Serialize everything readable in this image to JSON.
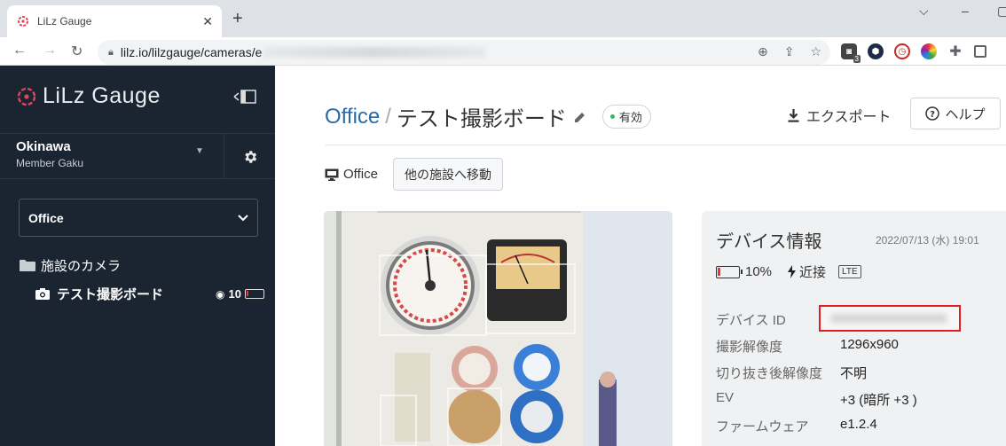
{
  "browser": {
    "tab_title": "LiLz Gauge",
    "url_prefix": "lilz.io/lilzgauge/cameras/",
    "url_visible_char": "e",
    "ext_badge": "3"
  },
  "sidebar": {
    "brand": "LiLz Gauge",
    "account_name": "Okinawa",
    "account_role": "Member Gaku",
    "facility_select": "Office",
    "folder_label": "施設のカメラ",
    "camera_label": "テスト撮影ボード",
    "camera_count": "10"
  },
  "main": {
    "breadcrumb_root": "Office",
    "breadcrumb_sep": "/",
    "title": "テスト撮影ボード",
    "status": "有効",
    "export_label": "エクスポート",
    "help_label": "ヘルプ",
    "location": "Office",
    "move_button": "他の施設へ移動"
  },
  "device": {
    "heading": "デバイス情報",
    "updated": "2022/07/13 (水) 19:01",
    "battery": "10%",
    "signal": "近接",
    "network": "LTE",
    "rows": [
      {
        "key": "デバイス ID",
        "value": ""
      },
      {
        "key": "撮影解像度",
        "value": "1296x960"
      },
      {
        "key": "切り抜き後解像度",
        "value": "不明"
      },
      {
        "key": "EV",
        "value": "+3 (暗所 +3 )"
      },
      {
        "key": "ファームウェア",
        "value": "e1.2.4"
      }
    ]
  },
  "colors": {
    "sidebar_bg": "#1b2431",
    "brand_red": "#e0455a",
    "link_blue": "#2a6aa6",
    "status_green": "#3cb371",
    "highlight_red": "#e02020"
  }
}
